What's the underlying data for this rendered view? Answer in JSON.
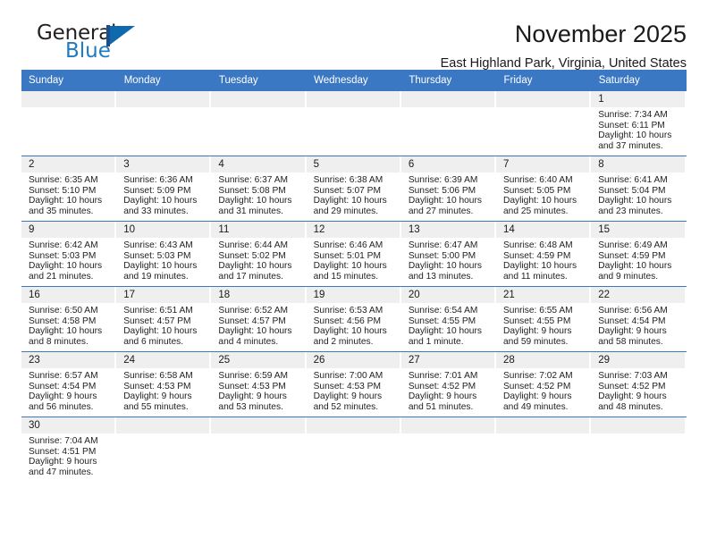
{
  "logo": {
    "word1": "General",
    "word2": "Blue",
    "mark": "triangle-mark",
    "color_dark": "#231f20",
    "color_blue": "#1f7bc1"
  },
  "header": {
    "title": "November 2025",
    "location": "East Highland Park, Virginia, United States",
    "accent_color": "#3b78c3",
    "daynum_band_color": "#efefef"
  },
  "weekdays": [
    "Sunday",
    "Monday",
    "Tuesday",
    "Wednesday",
    "Thursday",
    "Friday",
    "Saturday"
  ],
  "labels": {
    "sunrise": "Sunrise:",
    "sunset": "Sunset:",
    "daylight": "Daylight:"
  },
  "weeks": [
    [
      {
        "empty": true
      },
      {
        "empty": true
      },
      {
        "empty": true
      },
      {
        "empty": true
      },
      {
        "empty": true
      },
      {
        "empty": true
      },
      {
        "day": "1",
        "sunrise": "Sunrise: 7:34 AM",
        "sunset": "Sunset: 6:11 PM",
        "daylight1": "Daylight: 10 hours",
        "daylight2": "and 37 minutes."
      }
    ],
    [
      {
        "day": "2",
        "sunrise": "Sunrise: 6:35 AM",
        "sunset": "Sunset: 5:10 PM",
        "daylight1": "Daylight: 10 hours",
        "daylight2": "and 35 minutes."
      },
      {
        "day": "3",
        "sunrise": "Sunrise: 6:36 AM",
        "sunset": "Sunset: 5:09 PM",
        "daylight1": "Daylight: 10 hours",
        "daylight2": "and 33 minutes."
      },
      {
        "day": "4",
        "sunrise": "Sunrise: 6:37 AM",
        "sunset": "Sunset: 5:08 PM",
        "daylight1": "Daylight: 10 hours",
        "daylight2": "and 31 minutes."
      },
      {
        "day": "5",
        "sunrise": "Sunrise: 6:38 AM",
        "sunset": "Sunset: 5:07 PM",
        "daylight1": "Daylight: 10 hours",
        "daylight2": "and 29 minutes."
      },
      {
        "day": "6",
        "sunrise": "Sunrise: 6:39 AM",
        "sunset": "Sunset: 5:06 PM",
        "daylight1": "Daylight: 10 hours",
        "daylight2": "and 27 minutes."
      },
      {
        "day": "7",
        "sunrise": "Sunrise: 6:40 AM",
        "sunset": "Sunset: 5:05 PM",
        "daylight1": "Daylight: 10 hours",
        "daylight2": "and 25 minutes."
      },
      {
        "day": "8",
        "sunrise": "Sunrise: 6:41 AM",
        "sunset": "Sunset: 5:04 PM",
        "daylight1": "Daylight: 10 hours",
        "daylight2": "and 23 minutes."
      }
    ],
    [
      {
        "day": "9",
        "sunrise": "Sunrise: 6:42 AM",
        "sunset": "Sunset: 5:03 PM",
        "daylight1": "Daylight: 10 hours",
        "daylight2": "and 21 minutes."
      },
      {
        "day": "10",
        "sunrise": "Sunrise: 6:43 AM",
        "sunset": "Sunset: 5:03 PM",
        "daylight1": "Daylight: 10 hours",
        "daylight2": "and 19 minutes."
      },
      {
        "day": "11",
        "sunrise": "Sunrise: 6:44 AM",
        "sunset": "Sunset: 5:02 PM",
        "daylight1": "Daylight: 10 hours",
        "daylight2": "and 17 minutes."
      },
      {
        "day": "12",
        "sunrise": "Sunrise: 6:46 AM",
        "sunset": "Sunset: 5:01 PM",
        "daylight1": "Daylight: 10 hours",
        "daylight2": "and 15 minutes."
      },
      {
        "day": "13",
        "sunrise": "Sunrise: 6:47 AM",
        "sunset": "Sunset: 5:00 PM",
        "daylight1": "Daylight: 10 hours",
        "daylight2": "and 13 minutes."
      },
      {
        "day": "14",
        "sunrise": "Sunrise: 6:48 AM",
        "sunset": "Sunset: 4:59 PM",
        "daylight1": "Daylight: 10 hours",
        "daylight2": "and 11 minutes."
      },
      {
        "day": "15",
        "sunrise": "Sunrise: 6:49 AM",
        "sunset": "Sunset: 4:59 PM",
        "daylight1": "Daylight: 10 hours",
        "daylight2": "and 9 minutes."
      }
    ],
    [
      {
        "day": "16",
        "sunrise": "Sunrise: 6:50 AM",
        "sunset": "Sunset: 4:58 PM",
        "daylight1": "Daylight: 10 hours",
        "daylight2": "and 8 minutes."
      },
      {
        "day": "17",
        "sunrise": "Sunrise: 6:51 AM",
        "sunset": "Sunset: 4:57 PM",
        "daylight1": "Daylight: 10 hours",
        "daylight2": "and 6 minutes."
      },
      {
        "day": "18",
        "sunrise": "Sunrise: 6:52 AM",
        "sunset": "Sunset: 4:57 PM",
        "daylight1": "Daylight: 10 hours",
        "daylight2": "and 4 minutes."
      },
      {
        "day": "19",
        "sunrise": "Sunrise: 6:53 AM",
        "sunset": "Sunset: 4:56 PM",
        "daylight1": "Daylight: 10 hours",
        "daylight2": "and 2 minutes."
      },
      {
        "day": "20",
        "sunrise": "Sunrise: 6:54 AM",
        "sunset": "Sunset: 4:55 PM",
        "daylight1": "Daylight: 10 hours",
        "daylight2": "and 1 minute."
      },
      {
        "day": "21",
        "sunrise": "Sunrise: 6:55 AM",
        "sunset": "Sunset: 4:55 PM",
        "daylight1": "Daylight: 9 hours",
        "daylight2": "and 59 minutes."
      },
      {
        "day": "22",
        "sunrise": "Sunrise: 6:56 AM",
        "sunset": "Sunset: 4:54 PM",
        "daylight1": "Daylight: 9 hours",
        "daylight2": "and 58 minutes."
      }
    ],
    [
      {
        "day": "23",
        "sunrise": "Sunrise: 6:57 AM",
        "sunset": "Sunset: 4:54 PM",
        "daylight1": "Daylight: 9 hours",
        "daylight2": "and 56 minutes."
      },
      {
        "day": "24",
        "sunrise": "Sunrise: 6:58 AM",
        "sunset": "Sunset: 4:53 PM",
        "daylight1": "Daylight: 9 hours",
        "daylight2": "and 55 minutes."
      },
      {
        "day": "25",
        "sunrise": "Sunrise: 6:59 AM",
        "sunset": "Sunset: 4:53 PM",
        "daylight1": "Daylight: 9 hours",
        "daylight2": "and 53 minutes."
      },
      {
        "day": "26",
        "sunrise": "Sunrise: 7:00 AM",
        "sunset": "Sunset: 4:53 PM",
        "daylight1": "Daylight: 9 hours",
        "daylight2": "and 52 minutes."
      },
      {
        "day": "27",
        "sunrise": "Sunrise: 7:01 AM",
        "sunset": "Sunset: 4:52 PM",
        "daylight1": "Daylight: 9 hours",
        "daylight2": "and 51 minutes."
      },
      {
        "day": "28",
        "sunrise": "Sunrise: 7:02 AM",
        "sunset": "Sunset: 4:52 PM",
        "daylight1": "Daylight: 9 hours",
        "daylight2": "and 49 minutes."
      },
      {
        "day": "29",
        "sunrise": "Sunrise: 7:03 AM",
        "sunset": "Sunset: 4:52 PM",
        "daylight1": "Daylight: 9 hours",
        "daylight2": "and 48 minutes."
      }
    ],
    [
      {
        "day": "30",
        "sunrise": "Sunrise: 7:04 AM",
        "sunset": "Sunset: 4:51 PM",
        "daylight1": "Daylight: 9 hours",
        "daylight2": "and 47 minutes."
      },
      {
        "empty": true
      },
      {
        "empty": true
      },
      {
        "empty": true
      },
      {
        "empty": true
      },
      {
        "empty": true
      },
      {
        "empty": true
      }
    ]
  ]
}
